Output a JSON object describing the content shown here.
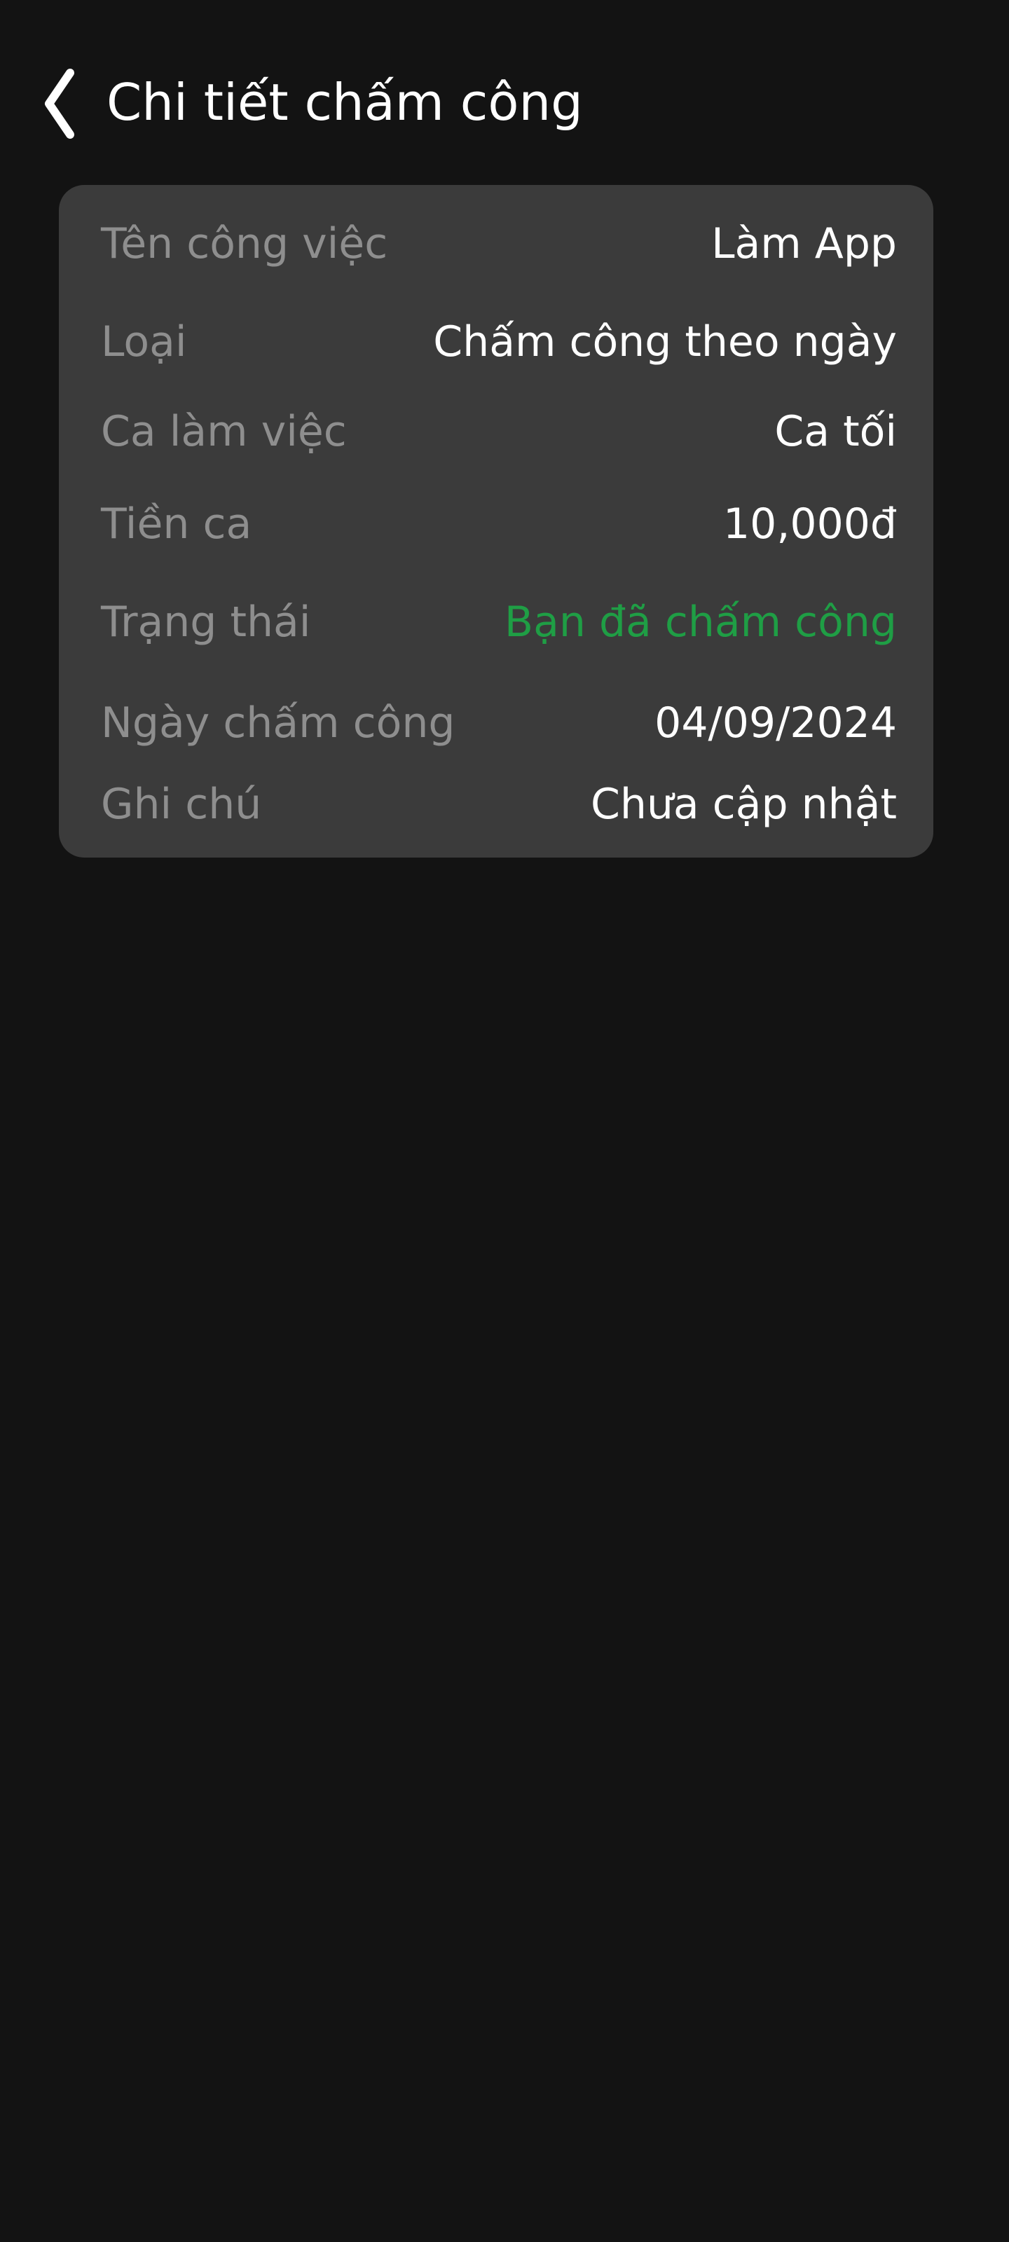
{
  "header": {
    "back_icon": "chevron-left-icon",
    "title": "Chi tiết chấm công"
  },
  "details": {
    "rows": [
      {
        "label": "Tên công việc",
        "value": "Làm App"
      },
      {
        "label": "Loại",
        "value": "Chấm công theo ngày"
      },
      {
        "label": "Ca làm việc",
        "value": "Ca tối"
      },
      {
        "label": "Tiền ca",
        "value": "10,000đ"
      },
      {
        "label": "Trạng thái",
        "value": "Bạn đã chấm công"
      },
      {
        "label": "Ngày chấm công",
        "value": "04/09/2024"
      },
      {
        "label": "Ghi chú",
        "value": "Chưa cập nhật"
      }
    ]
  },
  "colors": {
    "background": "#131313",
    "card": "#3b3b3b",
    "label": "#8e8e8e",
    "value": "#ffffff",
    "status_success": "#1f9e45"
  }
}
